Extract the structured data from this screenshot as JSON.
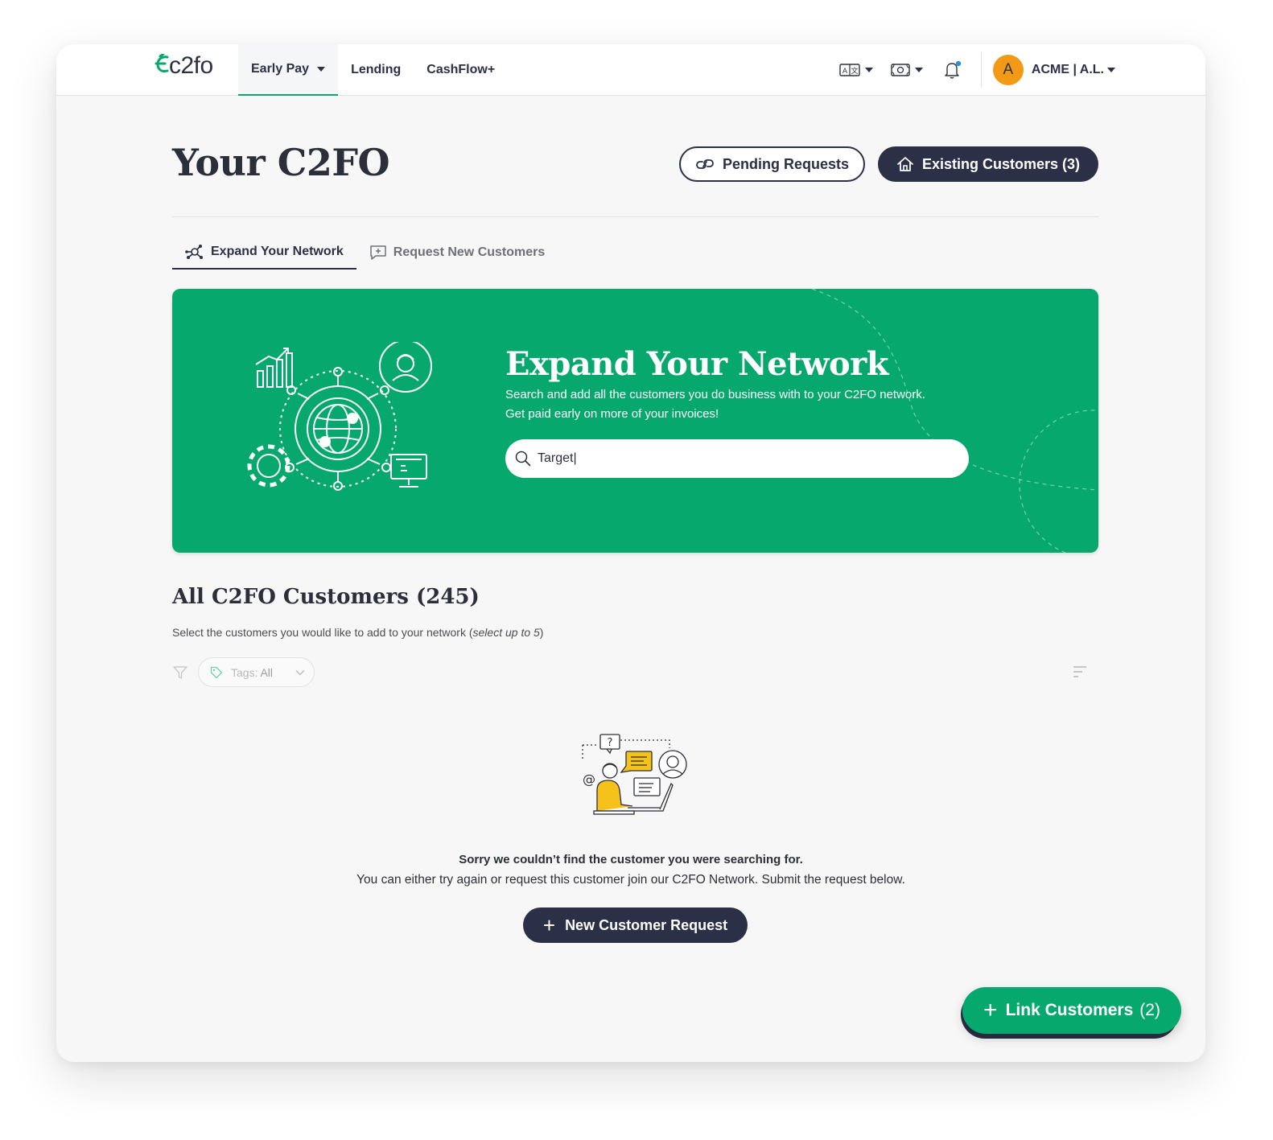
{
  "brand": {
    "logo_text": "c2fo",
    "accent_color": "#07a86d",
    "dark_color": "#2b3046",
    "avatar_color": "#f29a16"
  },
  "nav": {
    "items": [
      {
        "label": "Early Pay",
        "active": true,
        "has_dropdown": true
      },
      {
        "label": "Lending",
        "active": false
      },
      {
        "label": "CashFlow+",
        "active": false
      }
    ]
  },
  "toolbar": {
    "language_icon": "language-icon",
    "currency_icon": "currency-icon",
    "notifications_icon": "bell-icon",
    "avatar_initial": "A",
    "account_label": "ACME |  A.L."
  },
  "page": {
    "title": "Your C2FO",
    "pending_button": "Pending Requests",
    "existing_button": "Existing Customers (3)"
  },
  "tabs": [
    {
      "label": "Expand Your Network",
      "icon": "network-icon",
      "active": true
    },
    {
      "label": "Request New Customers",
      "icon": "add-message-icon",
      "active": false
    }
  ],
  "hero": {
    "title": "Expand Your Network",
    "subtitle_line1": "Search and add all the customers you do business with to your C2FO network.",
    "subtitle_line2": "Get paid early on more of your invoices!",
    "search_value": "Target|"
  },
  "customers": {
    "title": "All C2FO Customers (245)",
    "subtitle_prefix": "Select the customers you would like to add to your network (",
    "subtitle_emph": "select up to 5",
    "subtitle_suffix": ")",
    "tags_label": "Tags:",
    "tags_value": "All"
  },
  "empty_state": {
    "title": "Sorry we couldn’t find the customer you were searching for.",
    "message": "You can either try again or request this customer join our C2FO Network. Submit the request below.",
    "button_label": "New Customer Request"
  },
  "fab": {
    "label": "Link Customers",
    "count": "(2)"
  }
}
